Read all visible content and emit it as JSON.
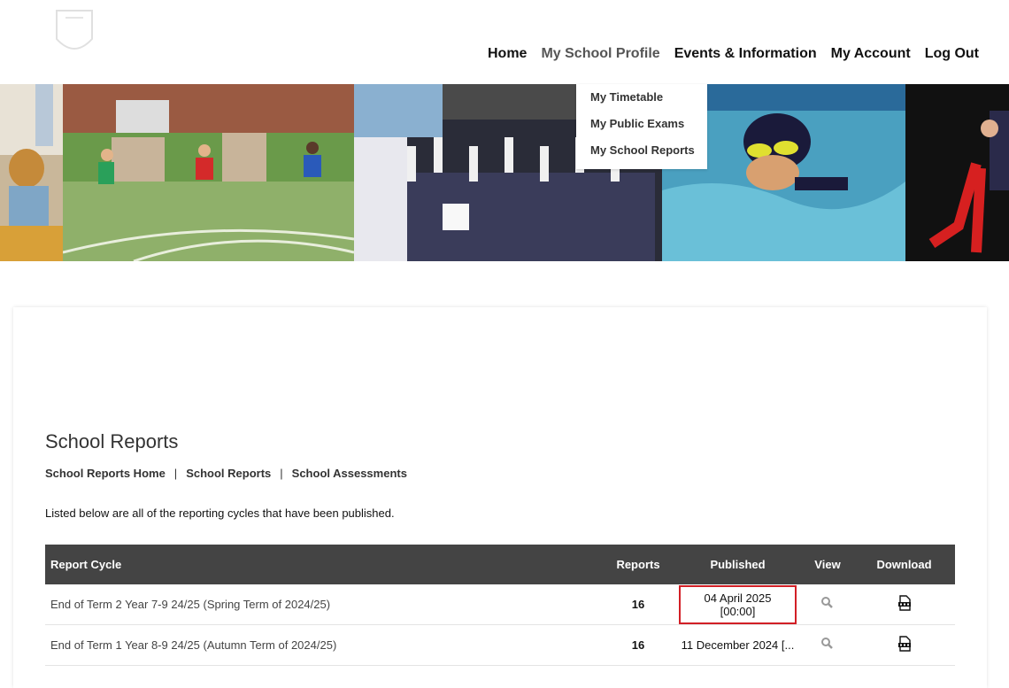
{
  "header": {
    "nav": [
      {
        "label": "Home"
      },
      {
        "label": "My School Profile",
        "active": true
      },
      {
        "label": "Events & Information"
      },
      {
        "label": "My Account"
      },
      {
        "label": "Log Out"
      }
    ],
    "dropdown": [
      {
        "label": "My Timetable"
      },
      {
        "label": "My Public Exams"
      },
      {
        "label": "My School Reports"
      }
    ]
  },
  "page": {
    "title": "School Reports",
    "subnav": [
      "School Reports Home",
      "School Reports",
      "School Assessments"
    ],
    "intro": "Listed below are all of the reporting cycles that have been published."
  },
  "table": {
    "headers": [
      "Report Cycle",
      "Reports",
      "Published",
      "View",
      "Download"
    ],
    "rows": [
      {
        "cycle": "End of Term 2 Year 7-9 24/25 (Spring Term of 2024/25)",
        "reports": "16",
        "published": "04 April 2025 [00:00]",
        "highlighted": true
      },
      {
        "cycle": "End of Term 1 Year 8-9 24/25 (Autumn Term of 2024/25)",
        "reports": "16",
        "published": "11 December 2024 [..."
      }
    ]
  },
  "icons": {
    "view": "magnifier-icon",
    "download": "pdf-icon"
  },
  "colors": {
    "header_bg": "#444444",
    "highlight": "#d21f26"
  }
}
